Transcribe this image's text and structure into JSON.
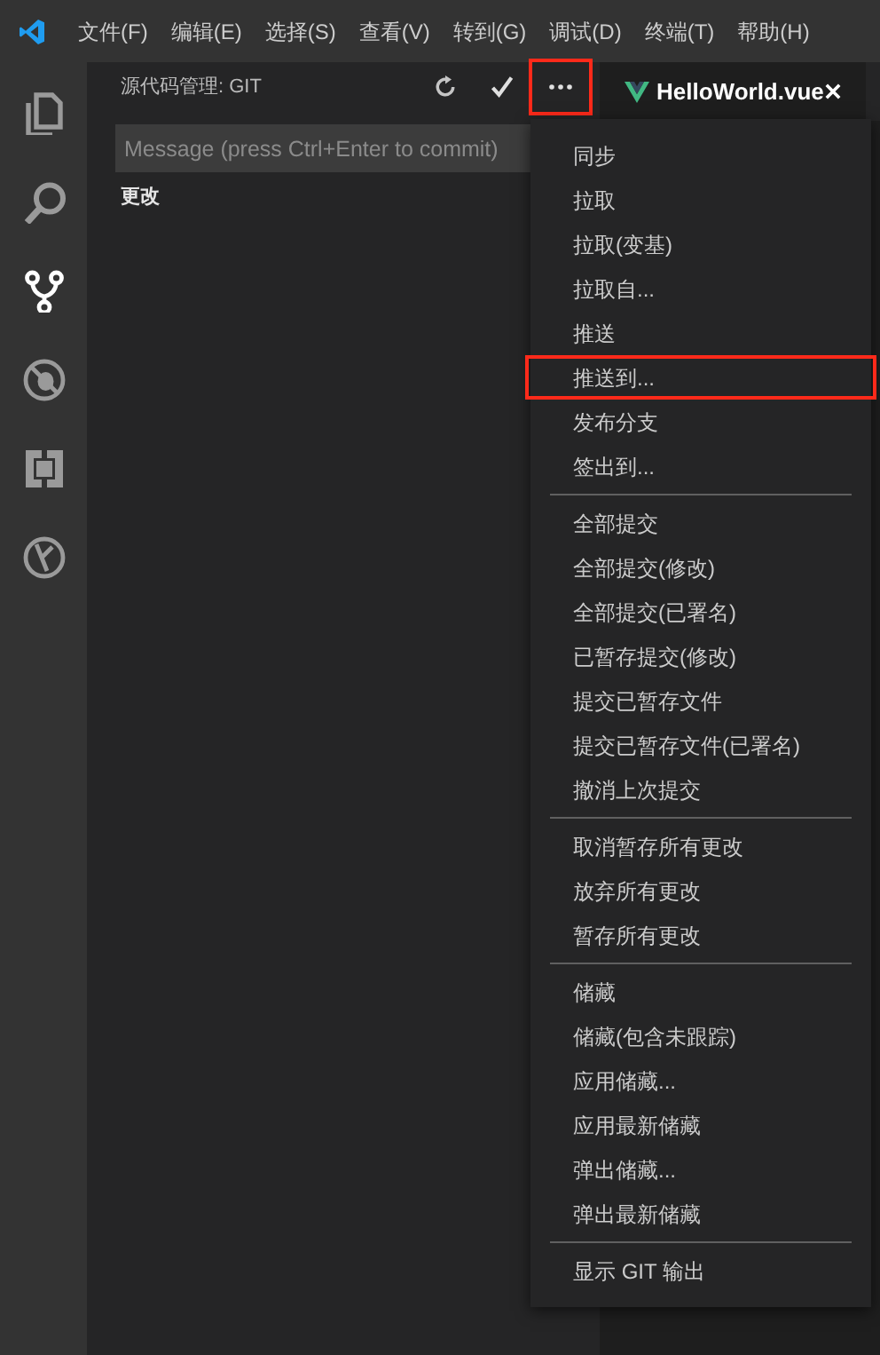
{
  "menu_bar": {
    "items": [
      "文件(F)",
      "编辑(E)",
      "选择(S)",
      "查看(V)",
      "转到(G)",
      "调试(D)",
      "终端(T)",
      "帮助(H)"
    ]
  },
  "activity_bar": {
    "items": [
      {
        "kind": "files",
        "selected": false
      },
      {
        "kind": "search",
        "selected": false
      },
      {
        "kind": "scm",
        "selected": true
      },
      {
        "kind": "debug",
        "selected": false
      },
      {
        "kind": "extensions",
        "selected": false
      },
      {
        "kind": "gitlens",
        "selected": false
      }
    ]
  },
  "scm_panel": {
    "title": "源代码管理: GIT",
    "more_highlighted": true,
    "message": {
      "placeholder": "Message (press Ctrl+Enter to commit)"
    },
    "section": "更改"
  },
  "editor_tab": {
    "label": "HelloWorld.vue"
  },
  "context_menu": {
    "groups": [
      [
        {
          "label": "同步",
          "highlighted": false
        },
        {
          "label": "拉取",
          "highlighted": false
        },
        {
          "label": "拉取(变基)",
          "highlighted": false
        },
        {
          "label": "拉取自...",
          "highlighted": false
        },
        {
          "label": "推送",
          "highlighted": false
        },
        {
          "label": "推送到...",
          "highlighted": true
        },
        {
          "label": "发布分支",
          "highlighted": false
        },
        {
          "label": "签出到...",
          "highlighted": false
        }
      ],
      [
        {
          "label": "全部提交",
          "highlighted": false
        },
        {
          "label": "全部提交(修改)",
          "highlighted": false
        },
        {
          "label": "全部提交(已署名)",
          "highlighted": false
        },
        {
          "label": "已暂存提交(修改)",
          "highlighted": false
        },
        {
          "label": "提交已暂存文件",
          "highlighted": false
        },
        {
          "label": "提交已暂存文件(已署名)",
          "highlighted": false
        },
        {
          "label": "撤消上次提交",
          "highlighted": false
        }
      ],
      [
        {
          "label": "取消暂存所有更改",
          "highlighted": false
        },
        {
          "label": "放弃所有更改",
          "highlighted": false
        },
        {
          "label": "暂存所有更改",
          "highlighted": false
        }
      ],
      [
        {
          "label": "储藏",
          "highlighted": false
        },
        {
          "label": "储藏(包含未跟踪)",
          "highlighted": false
        },
        {
          "label": "应用储藏...",
          "highlighted": false
        },
        {
          "label": "应用最新储藏",
          "highlighted": false
        },
        {
          "label": "弹出储藏...",
          "highlighted": false
        },
        {
          "label": "弹出最新储藏",
          "highlighted": false
        }
      ],
      [
        {
          "label": "显示 GIT 输出",
          "highlighted": false
        }
      ]
    ]
  }
}
